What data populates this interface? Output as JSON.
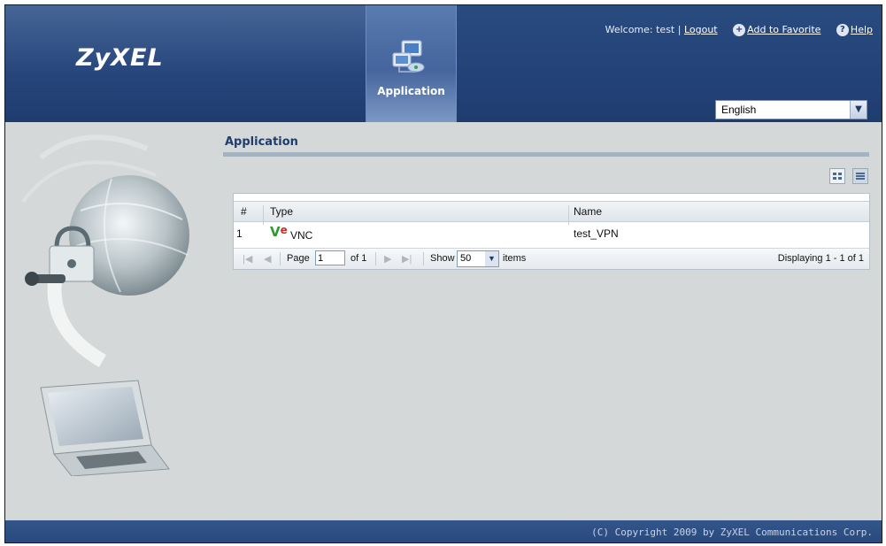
{
  "brand": {
    "logo": "ZyXEL"
  },
  "header": {
    "welcome_prefix": "Welcome: test |",
    "logout": "Logout",
    "add_favorite": "Add to Favorite",
    "help": "Help",
    "tab_label": "Application",
    "language": "English"
  },
  "content": {
    "title": "Application"
  },
  "grid": {
    "columns": [
      "#",
      "Type",
      "Name"
    ],
    "rows": [
      {
        "index": "1",
        "type_logo": "V",
        "type_logo2": "e",
        "type": "VNC",
        "name": "test_VPN"
      }
    ],
    "pager": {
      "page_label": "Page",
      "page_value": "1",
      "of_label": "of 1",
      "show_label": "Show",
      "show_value": "50",
      "items_label": "items",
      "displaying": "Displaying 1 - 1 of 1"
    }
  },
  "footer": {
    "copyright": "(C) Copyright 2009 by ZyXEL Communications Corp."
  },
  "colors": {
    "header": "#24447a",
    "accent": "#1f3c6e",
    "body": "#d4d8d8"
  }
}
